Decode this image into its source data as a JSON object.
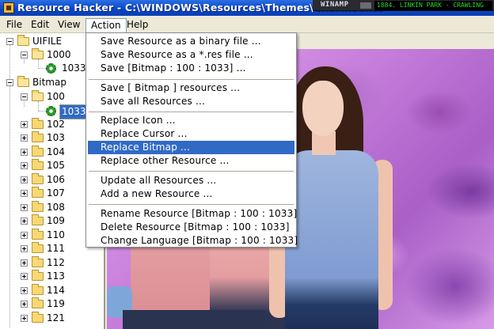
{
  "window": {
    "title": "Resource Hacker - C:\\WINDOWS\\Resources\\Themes\\Charmedlite"
  },
  "winamp": {
    "logo": "WINAMP",
    "display": "1884. LINKIN PARK - CRAWLING"
  },
  "menubar": {
    "items": [
      "File",
      "Edit",
      "View",
      "Action",
      "Help"
    ],
    "active": "Action"
  },
  "tree": {
    "uifile": {
      "label": "UIFILE",
      "child": "1000",
      "leaf": "1033"
    },
    "bitmap": {
      "label": "Bitmap",
      "child": "100",
      "leaf": "1033"
    },
    "folders": [
      "102",
      "103",
      "104",
      "105",
      "106",
      "107",
      "108",
      "109",
      "110",
      "111",
      "112",
      "113",
      "114",
      "119",
      "121"
    ]
  },
  "action_menu": {
    "items": [
      "Save Resource as a binary file ...",
      "Save Resource as a *.res file ...",
      "Save [Bitmap : 100 : 1033] ...",
      "Save [ Bitmap ] resources ...",
      "Save all Resources ...",
      "Replace Icon ...",
      "Replace Cursor ...",
      "Replace Bitmap ...",
      "Replace other Resource ...",
      "Update all Resources ...",
      "Add a new Resource ...",
      "Rename Resource [Bitmap : 100 : 1033]",
      "Delete Resource [Bitmap : 100 : 1033]",
      "Change Language [Bitmap : 100 : 1033]"
    ],
    "highlighted": "Replace Bitmap ..."
  },
  "colors": {
    "titlebar": "#0a46c8",
    "highlight": "#316ac5",
    "menubar": "#ece9d8"
  }
}
